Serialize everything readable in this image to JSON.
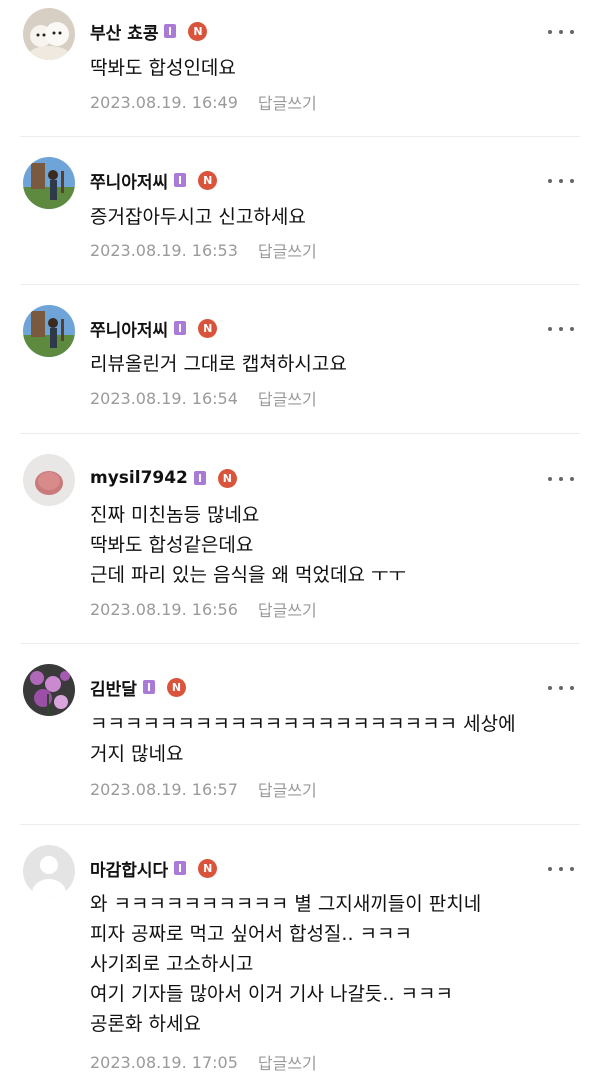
{
  "reply_label": "답글쓰기",
  "level_badge_color": "#a97ad6",
  "n_badge": {
    "label": "N",
    "color": "#d9543b"
  },
  "comments": [
    {
      "nickname": "부산 쵸콩",
      "avatar_icon": "white-puppies-avatar",
      "text": "딱봐도 합성인데요",
      "timestamp": "2023.08.19. 16:49"
    },
    {
      "nickname": "쭈니아저씨",
      "avatar_icon": "person-outdoor-avatar",
      "text": "증거잡아두시고 신고하세요",
      "timestamp": "2023.08.19. 16:53"
    },
    {
      "nickname": "쭈니아저씨",
      "avatar_icon": "person-outdoor-avatar",
      "text": "리뷰올린거 그대로 캡쳐하시고요",
      "timestamp": "2023.08.19. 16:54"
    },
    {
      "nickname": "mysil7942",
      "avatar_icon": "pink-blob-avatar",
      "text": "진짜 미친놈등 많네요\n딱봐도 합성같은데요\n근데 파리 있는 음식을 왜 먹었데요 ㅜㅜ",
      "timestamp": "2023.08.19. 16:56"
    },
    {
      "nickname": "김반달",
      "avatar_icon": "purple-flowers-avatar",
      "text": "ㅋㅋㅋㅋㅋㅋㅋㅋㅋㅋㅋㅋㅋㅋㅋㅋㅋㅋㅋㅋㅋ 세상에\n거지 많네요",
      "timestamp": "2023.08.19. 16:57"
    },
    {
      "nickname": "마감합시다",
      "avatar_icon": "default-profile-avatar",
      "text": "와 ㅋㅋㅋㅋㅋㅋㅋㅋㅋㅋ 별 그지새끼들이 판치네\n피자 공짜로 먹고 싶어서 합성질.. ㅋㅋㅋ\n사기죄로 고소하시고\n여기 기자들 많아서 이거 기사 나갈듯.. ㅋㅋㅋ\n공론화 하세요",
      "timestamp": "2023.08.19. 17:05"
    }
  ]
}
